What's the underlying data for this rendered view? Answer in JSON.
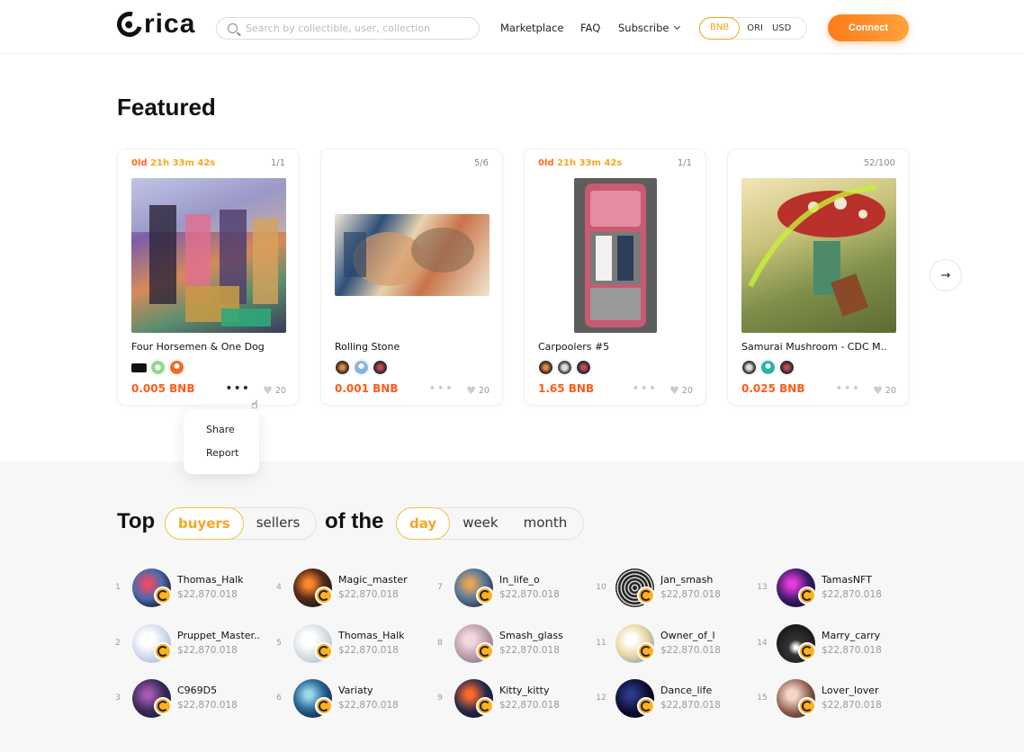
{
  "header": {
    "logo_text": "rica",
    "search_placeholder": "Search by collectible, user, collection",
    "nav": [
      "Marketplace",
      "FAQ",
      "Subscribe"
    ],
    "currencies": [
      "BNB",
      "ORI",
      "USD"
    ],
    "active_currency": "BNB",
    "connect_label": "Connect"
  },
  "featured": {
    "title": "Featured",
    "cards": [
      {
        "timer_days": "0ld",
        "timer_rest": "21h 33m 42s",
        "edition": "1/1",
        "name": "Four Horsemen & One Dog",
        "price": "0.005 BNB",
        "likes": "20"
      },
      {
        "timer_days": "",
        "timer_rest": "",
        "edition": "5/6",
        "name": "Rolling Stone",
        "price": "0.001 BNB",
        "likes": "20"
      },
      {
        "timer_days": "0ld",
        "timer_rest": "21h 33m 42s",
        "edition": "1/1",
        "name": "Carpoolers #5",
        "price": "1.65 BNB",
        "likes": "20"
      },
      {
        "timer_days": "",
        "timer_rest": "",
        "edition": "52/100",
        "name": "Samurai Mushroom - CDC M..",
        "price": "0.025 BNB",
        "likes": "20"
      }
    ],
    "menu": {
      "share": "Share",
      "report": "Report"
    }
  },
  "top": {
    "word_top": "Top",
    "word_of_the": "of the",
    "role_tabs": [
      "buyers",
      "sellers"
    ],
    "active_role": "buyers",
    "period_tabs": [
      "day",
      "week",
      "month"
    ],
    "active_period": "day",
    "users": [
      {
        "rank": "1",
        "name": "Thomas_Halk",
        "value": "$22,870.018"
      },
      {
        "rank": "2",
        "name": "Pruppet_Master..",
        "value": "$22,870.018"
      },
      {
        "rank": "3",
        "name": "C969D5",
        "value": "$22,870.018"
      },
      {
        "rank": "4",
        "name": "Magic_master",
        "value": "$22,870.018"
      },
      {
        "rank": "5",
        "name": "Thomas_Halk",
        "value": "$22,870.018"
      },
      {
        "rank": "6",
        "name": "Variaty",
        "value": "$22,870.018"
      },
      {
        "rank": "7",
        "name": "In_life_o",
        "value": "$22,870.018"
      },
      {
        "rank": "8",
        "name": "Smash_glass",
        "value": "$22,870.018"
      },
      {
        "rank": "9",
        "name": "Kitty_kitty",
        "value": "$22,870.018"
      },
      {
        "rank": "10",
        "name": "Jan_smash",
        "value": "$22,870.018"
      },
      {
        "rank": "11",
        "name": "Owner_of_l",
        "value": "$22,870.018"
      },
      {
        "rank": "12",
        "name": "Dance_life",
        "value": "$22,870.018"
      },
      {
        "rank": "13",
        "name": "TamasNFT",
        "value": "$22,870.018"
      },
      {
        "rank": "14",
        "name": "Marry_carry",
        "value": "$22,870.018"
      },
      {
        "rank": "15",
        "name": "Lover_lover",
        "value": "$22,870.018"
      }
    ]
  }
}
